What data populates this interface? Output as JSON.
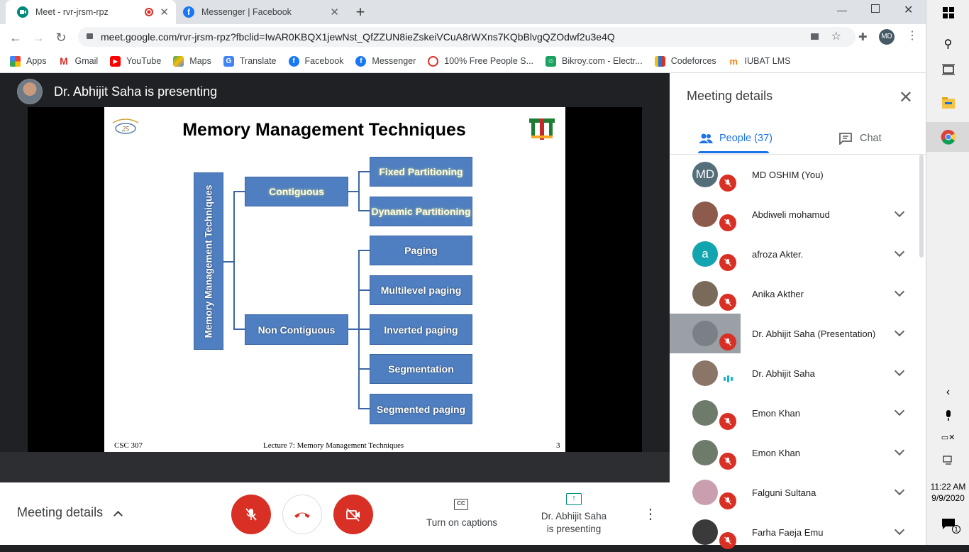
{
  "browser": {
    "tabs": [
      {
        "title": "Meet - rvr-jrsm-rpz",
        "active": true,
        "recording": true
      },
      {
        "title": "Messenger | Facebook",
        "active": false
      }
    ],
    "new_tab": "+",
    "url": "meet.google.com/rvr-jrsm-rpz?fbclid=IwAR0KBQX1jewNst_QfZZUN8ieZskeiVCuA8rWXns7KQbBlvgQZOdwf2u3e4Q",
    "profile_initials": "MD",
    "bookmarks": [
      {
        "label": "Apps",
        "icon": "apps-grid-icon"
      },
      {
        "label": "Gmail",
        "icon": "gmail-icon"
      },
      {
        "label": "YouTube",
        "icon": "youtube-icon"
      },
      {
        "label": "Maps",
        "icon": "maps-icon"
      },
      {
        "label": "Translate",
        "icon": "translate-icon"
      },
      {
        "label": "Facebook",
        "icon": "facebook-icon"
      },
      {
        "label": "Messenger",
        "icon": "facebook-icon"
      },
      {
        "label": "100% Free People S...",
        "icon": "crosshair-icon"
      },
      {
        "label": "Bikroy.com - Electr...",
        "icon": "bikroy-icon"
      },
      {
        "label": "Codeforces",
        "icon": "codeforces-icon"
      },
      {
        "label": "IUBAT LMS",
        "icon": "moodle-icon"
      }
    ]
  },
  "meet": {
    "presenter_text": "Dr. Abhijit Saha is presenting",
    "slide": {
      "title": "Memory Management Techniques",
      "logo_text": "CELEBRATING 25 Years",
      "vertical_label": "Memory Management Techniques",
      "contiguous": "Contiguous",
      "non_contiguous": "Non Contiguous",
      "contiguous_children": [
        "Fixed Partitioning",
        "Dynamic Partitioning"
      ],
      "non_contiguous_children": [
        "Paging",
        "Multilevel paging",
        "Inverted paging",
        "Segmentation",
        "Segmented paging"
      ],
      "footer_left": "CSC 307",
      "footer_center": "Lecture 7:  Memory Management Techniques",
      "footer_right": "3"
    },
    "controls": {
      "meeting_details": "Meeting details",
      "captions": "Turn on captions",
      "presenting_line1": "Dr. Abhijit Saha",
      "presenting_line2": "is presenting"
    }
  },
  "panel": {
    "title": "Meeting details",
    "tab_people": "People (37)",
    "tab_chat": "Chat",
    "people": [
      {
        "name": "MD OSHIM (You)",
        "initials": "MD",
        "color": "#546e7a",
        "status": "muted"
      },
      {
        "name": "Abdiweli mohamud",
        "initials": "",
        "color": "#8d5b4c",
        "status": "muted"
      },
      {
        "name": "afroza Akter.",
        "initials": "a",
        "color": "#12a4af",
        "status": "muted"
      },
      {
        "name": "Anika Akther",
        "initials": "",
        "color": "#7a6a5a",
        "status": "muted"
      },
      {
        "name": "Dr. Abhijit Saha (Presentation)",
        "initials": "",
        "color": "#7b8086",
        "status": "muted-audio"
      },
      {
        "name": "Dr. Abhijit Saha",
        "initials": "",
        "color": "#8a7566",
        "status": "speaking"
      },
      {
        "name": "Emon Khan",
        "initials": "",
        "color": "#6f7b6a",
        "status": "muted"
      },
      {
        "name": "Emon Khan",
        "initials": "",
        "color": "#6f7b6a",
        "status": "muted"
      },
      {
        "name": "Falguni Sultana",
        "initials": "",
        "color": "#c99fb0",
        "status": "muted"
      },
      {
        "name": "Farha Faeja Emu",
        "initials": "",
        "color": "#3a3a3a",
        "status": "muted"
      }
    ]
  },
  "taskbar": {
    "time": "11:22 AM",
    "date": "9/9/2020",
    "notification_count": "1"
  },
  "colors": {
    "meet_red": "#d93025",
    "google_blue": "#1a73e8",
    "slide_box": "#4f7fc0",
    "stage_bg": "#202124"
  }
}
